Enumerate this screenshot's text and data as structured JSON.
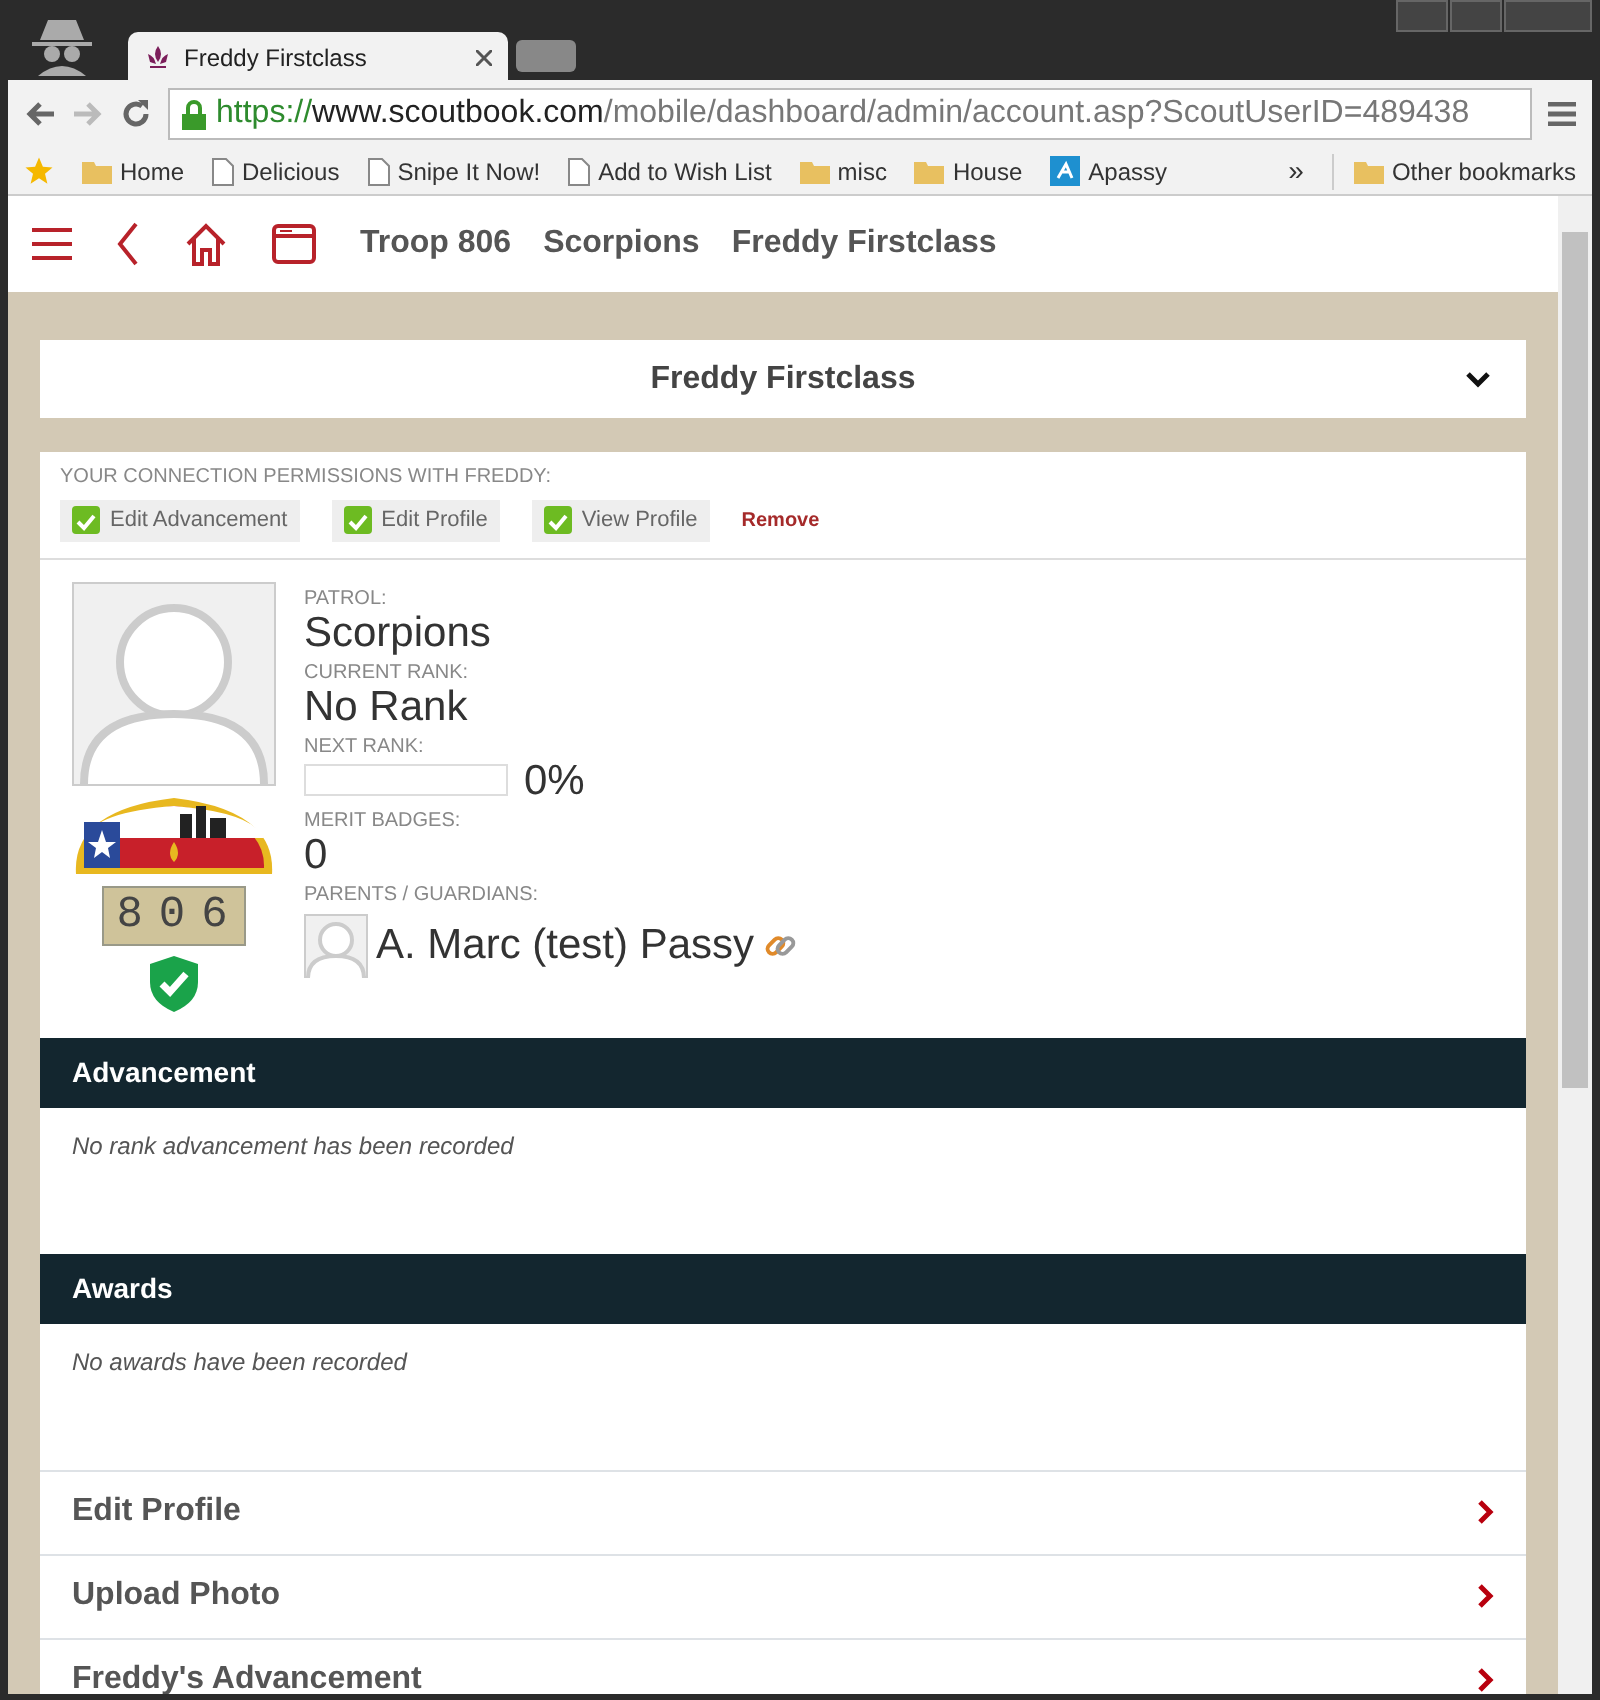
{
  "browser": {
    "tab": {
      "title": "Freddy Firstclass",
      "selected": true
    },
    "url": {
      "scheme": "https://",
      "host": "www.scoutbook.com",
      "path": "/mobile/dashboard/admin/account.asp?ScoutUserID=489438"
    },
    "bookmarks": [
      {
        "label": "Home",
        "kind": "folder"
      },
      {
        "label": "Delicious",
        "kind": "page"
      },
      {
        "label": "Snipe It Now!",
        "kind": "page"
      },
      {
        "label": "Add to Wish List",
        "kind": "page"
      },
      {
        "label": "misc",
        "kind": "folder"
      },
      {
        "label": "House",
        "kind": "folder"
      },
      {
        "label": "Apassy",
        "kind": "app"
      }
    ],
    "overflow": "»",
    "other_bookmarks": "Other bookmarks"
  },
  "nav": {
    "breadcrumbs": [
      "Troop 806",
      "Scorpions",
      "Freddy Firstclass"
    ]
  },
  "header": {
    "title": "Freddy Firstclass",
    "expanded": false
  },
  "permissions": {
    "heading": "YOUR CONNECTION PERMISSIONS WITH FREDDY:",
    "items": [
      {
        "label": "Edit Advancement",
        "checked": true
      },
      {
        "label": "Edit Profile",
        "checked": true
      },
      {
        "label": "View Profile",
        "checked": true
      }
    ],
    "remove": "Remove"
  },
  "profile": {
    "unit_number": "806",
    "patrol_label": "PATROL:",
    "patrol": "Scorpions",
    "current_rank_label": "CURRENT RANK:",
    "current_rank": "No Rank",
    "next_rank_label": "NEXT RANK:",
    "next_rank": {
      "level": 0,
      "reading": "0%"
    },
    "merit_badges_label": "MERIT BADGES:",
    "merit_badges": "0",
    "parents_label": "PARENTS / GUARDIANS:",
    "parents": [
      {
        "name": "A. Marc (test) Passy"
      }
    ]
  },
  "sections": [
    {
      "title": "Advancement",
      "empty_text": "No rank advancement has been recorded"
    },
    {
      "title": "Awards",
      "empty_text": "No awards have been recorded"
    }
  ],
  "links": [
    {
      "label": "Edit Profile"
    },
    {
      "label": "Upload Photo"
    },
    {
      "label": "Freddy's Advancement"
    }
  ]
}
